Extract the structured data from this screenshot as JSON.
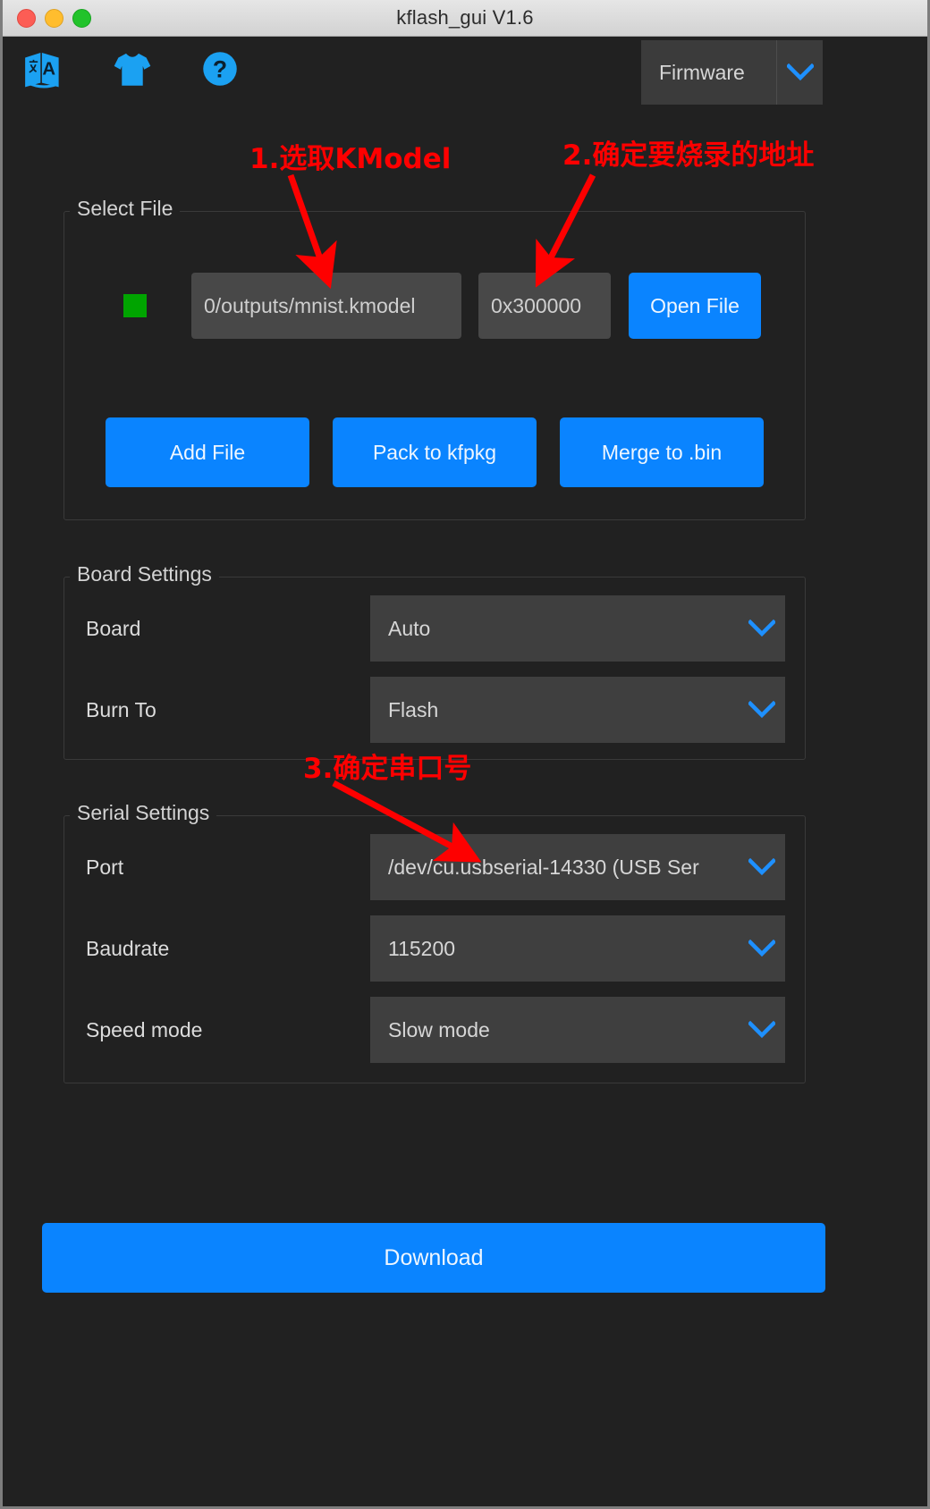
{
  "window": {
    "title": "kflash_gui V1.6",
    "traffic_lights": [
      "close",
      "minimize",
      "maximize"
    ],
    "accent_color": "#0a84ff",
    "background_color": "#212121",
    "annotation_color": "#fe0000"
  },
  "toolbar": {
    "icons": [
      {
        "name": "translate-icon",
        "label": "Language"
      },
      {
        "name": "tshirt-icon",
        "label": "Theme"
      },
      {
        "name": "help-icon",
        "label": "Help"
      }
    ],
    "mode_select": {
      "value": "Firmware",
      "arrow": "chevron-down-icon"
    }
  },
  "select_file": {
    "group_title": "Select File",
    "status_indicator_color": "#00a400",
    "file_path": "0/outputs/mnist.kmodel",
    "address": "0x300000",
    "open_file_label": "Open File",
    "buttons": [
      {
        "name": "add-file-button",
        "label": "Add File"
      },
      {
        "name": "pack-to-kfpkg-button",
        "label": "Pack to kfpkg"
      },
      {
        "name": "merge-to-bin-button",
        "label": "Merge to .bin"
      }
    ]
  },
  "board_settings": {
    "group_title": "Board Settings",
    "rows": [
      {
        "label": "Board",
        "value": "Auto"
      },
      {
        "label": "Burn To",
        "value": "Flash"
      }
    ]
  },
  "serial_settings": {
    "group_title": "Serial Settings",
    "rows": [
      {
        "label": "Port",
        "value": "/dev/cu.usbserial-14330 (USB Ser"
      },
      {
        "label": "Baudrate",
        "value": "115200"
      },
      {
        "label": "Speed mode",
        "value": "Slow mode"
      }
    ]
  },
  "download": {
    "label": "Download"
  },
  "annotations": [
    {
      "id": "anno1",
      "text": "1.选取KModel"
    },
    {
      "id": "anno2",
      "text": "2.确定要烧录的地址"
    },
    {
      "id": "anno3",
      "text": "3.确定串口号"
    }
  ]
}
